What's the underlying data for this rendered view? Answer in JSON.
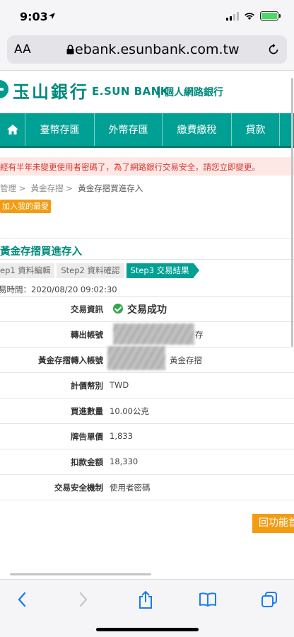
{
  "status": {
    "time": "9:03"
  },
  "browser": {
    "aa_label": "AA",
    "url": "ebank.esunbank.com.tw"
  },
  "header": {
    "logo_cn": "玉山銀行",
    "logo_en": "E.SUN BANK",
    "logo_personal": "個人網路銀行"
  },
  "nav": {
    "items": [
      "臺幣存匯",
      "外幣存匯",
      "繳費繳稅",
      "貸款"
    ]
  },
  "notice": {
    "text": "經有半年未變更使用者密碼了，為了網路銀行交易安全，請您",
    "link": "立即變更",
    "suffix": "。"
  },
  "breadcrumb": {
    "items": [
      "管理 >",
      "黃金存摺 >"
    ],
    "current": "黃金存摺買進存入"
  },
  "fav_button": "加入我的最愛",
  "section_title": "黃金存摺買進存入",
  "steps": [
    {
      "label": "ep1  資料編輯",
      "active": false
    },
    {
      "label": "Step2  資料確認",
      "active": false
    },
    {
      "label": "Step3  交易結果",
      "active": true
    }
  ],
  "transaction_time": "易時間：2020/08/20 09:02:30",
  "result": {
    "status_label": "交易資訊",
    "status_value": "交易成功",
    "rows": [
      {
        "label": "轉出帳號",
        "value": "存"
      },
      {
        "label": "黃金存摺轉入帳號",
        "value": "黃金存摺"
      },
      {
        "label": "計價幣別",
        "value": "TWD"
      },
      {
        "label": "買進數量",
        "value": "10.00公克"
      },
      {
        "label": "牌告單價",
        "value": "1,833"
      },
      {
        "label": "扣款金額",
        "value": "18,330"
      },
      {
        "label": "交易安全機制",
        "value": "使用者密碼"
      }
    ]
  },
  "back_button": "回功能首",
  "colors": {
    "brand": "#00a095",
    "accent": "#f39c12",
    "notice": "#d9332c"
  }
}
